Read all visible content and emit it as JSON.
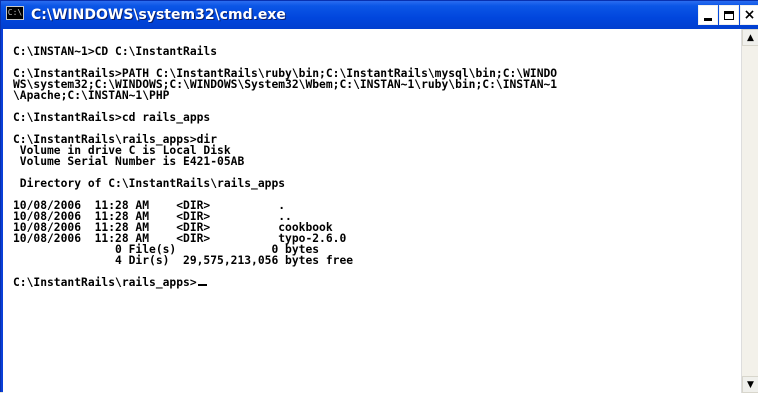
{
  "window": {
    "title": "C:\\WINDOWS\\system32\\cmd.exe",
    "icon": "C:\\",
    "minimize_icon": "minimize-icon",
    "maximize_icon": "maximize-icon",
    "close_icon": "close-icon",
    "close_label": "×"
  },
  "console": {
    "lines": [
      "",
      "C:\\INSTAN~1>CD C:\\InstantRails",
      "",
      "C:\\InstantRails>PATH C:\\InstantRails\\ruby\\bin;C:\\InstantRails\\mysql\\bin;C:\\WINDO",
      "WS\\system32;C:\\WINDOWS;C:\\WINDOWS\\System32\\Wbem;C:\\INSTAN~1\\ruby\\bin;C:\\INSTAN~1",
      "\\Apache;C:\\INSTAN~1\\PHP",
      "",
      "C:\\InstantRails>cd rails_apps",
      "",
      "C:\\InstantRails\\rails_apps>dir",
      " Volume in drive C is Local Disk",
      " Volume Serial Number is E421-05AB",
      "",
      " Directory of C:\\InstantRails\\rails_apps",
      "",
      "10/08/2006  11:28 AM    <DIR>          .",
      "10/08/2006  11:28 AM    <DIR>          ..",
      "10/08/2006  11:28 AM    <DIR>          cookbook",
      "10/08/2006  11:28 AM    <DIR>          typo-2.6.0",
      "               0 File(s)              0 bytes",
      "               4 Dir(s)  29,575,213,056 bytes free",
      "",
      "C:\\InstantRails\\rails_apps>"
    ]
  },
  "scrollbar": {
    "up_icon": "scroll-up-arrow-icon",
    "down_icon": "scroll-down-arrow-icon",
    "up_glyph": "▲",
    "down_glyph": "▼"
  }
}
